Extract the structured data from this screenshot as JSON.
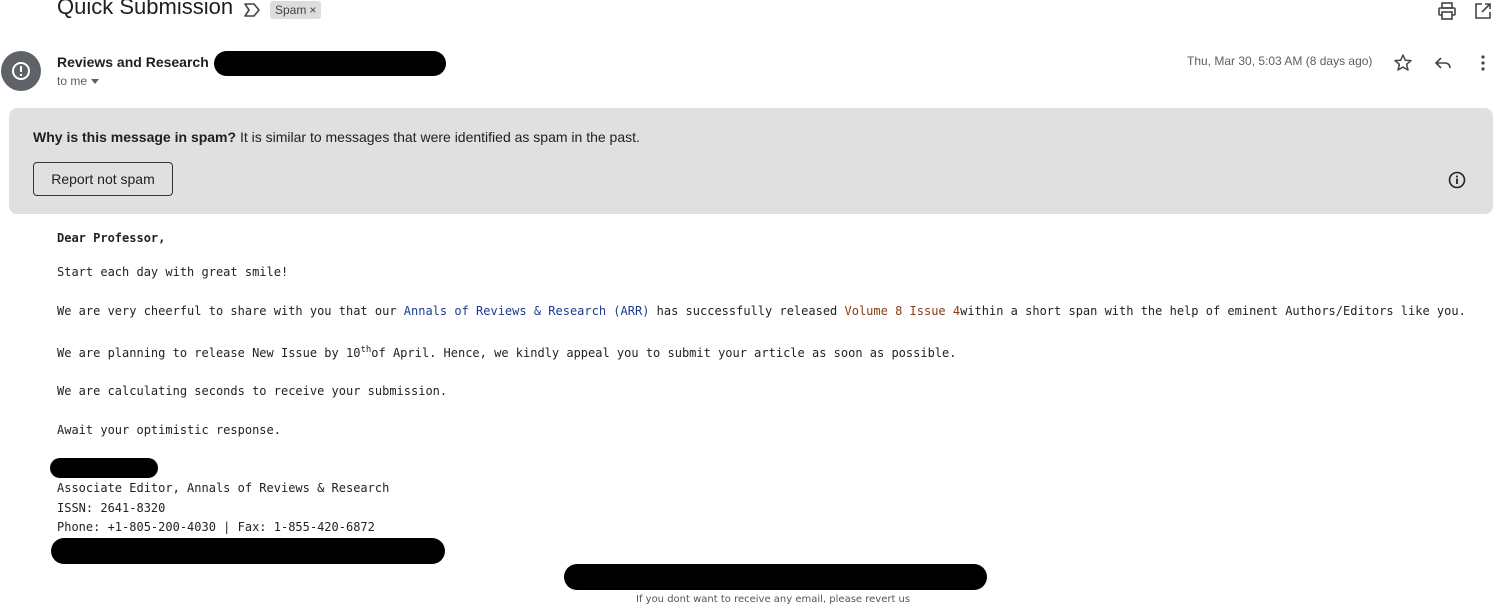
{
  "header": {
    "subject": "Quick Submission",
    "label_chip": "Spam",
    "chip_remove": "×"
  },
  "message": {
    "sender": "Reviews and Research",
    "recipient": "to me",
    "date": "Thu, Mar 30, 5:03 AM (8 days ago)"
  },
  "spam_banner": {
    "question": "Why is this message in spam?",
    "explanation": " It is similar to messages that were identified as spam in the past.",
    "button_label": "Report not spam"
  },
  "body": {
    "greeting": "Dear Professor,",
    "line1": "Start each day with great smile!",
    "line2_a": "We are very cheerful to share with you that our ",
    "line2_link": "Annals of Reviews & Research (ARR)",
    "line2_b": " has successfully released ",
    "line2_issue": "Volume 8 Issue 4",
    "line2_c": "within a short span with the help of eminent Authors/Editors like you.",
    "line3_a": "We are planning to release New Issue by 10",
    "line3_sup": "th",
    "line3_b": "of April. Hence, we kindly appeal you to submit your article as soon as possible.",
    "line4": "We are calculating seconds to receive your submission.",
    "line5": "Await your optimistic response."
  },
  "signature": {
    "title": "Associate Editor, Annals of Reviews & Research",
    "issn": "ISSN: 2641-8320",
    "contact": "Phone: +1-805-200-4030 | Fax: 1-855-420-6872"
  },
  "footer": {
    "unsubscribe": "If you dont want to receive any email, please revert us"
  },
  "icons": {
    "label": "label-outline-icon",
    "print": "print-icon",
    "open_new": "open-in-new-window-icon",
    "avatar": "spam-alert-icon",
    "star": "star-icon",
    "reply": "reply-icon",
    "more": "more-vertical-icon",
    "info": "info-icon"
  },
  "colors": {
    "banner_bg": "#e0e0e0",
    "link_blue": "#1a3d8f",
    "issue_brown": "#8a3b12",
    "avatar_bg": "#5f6368"
  }
}
